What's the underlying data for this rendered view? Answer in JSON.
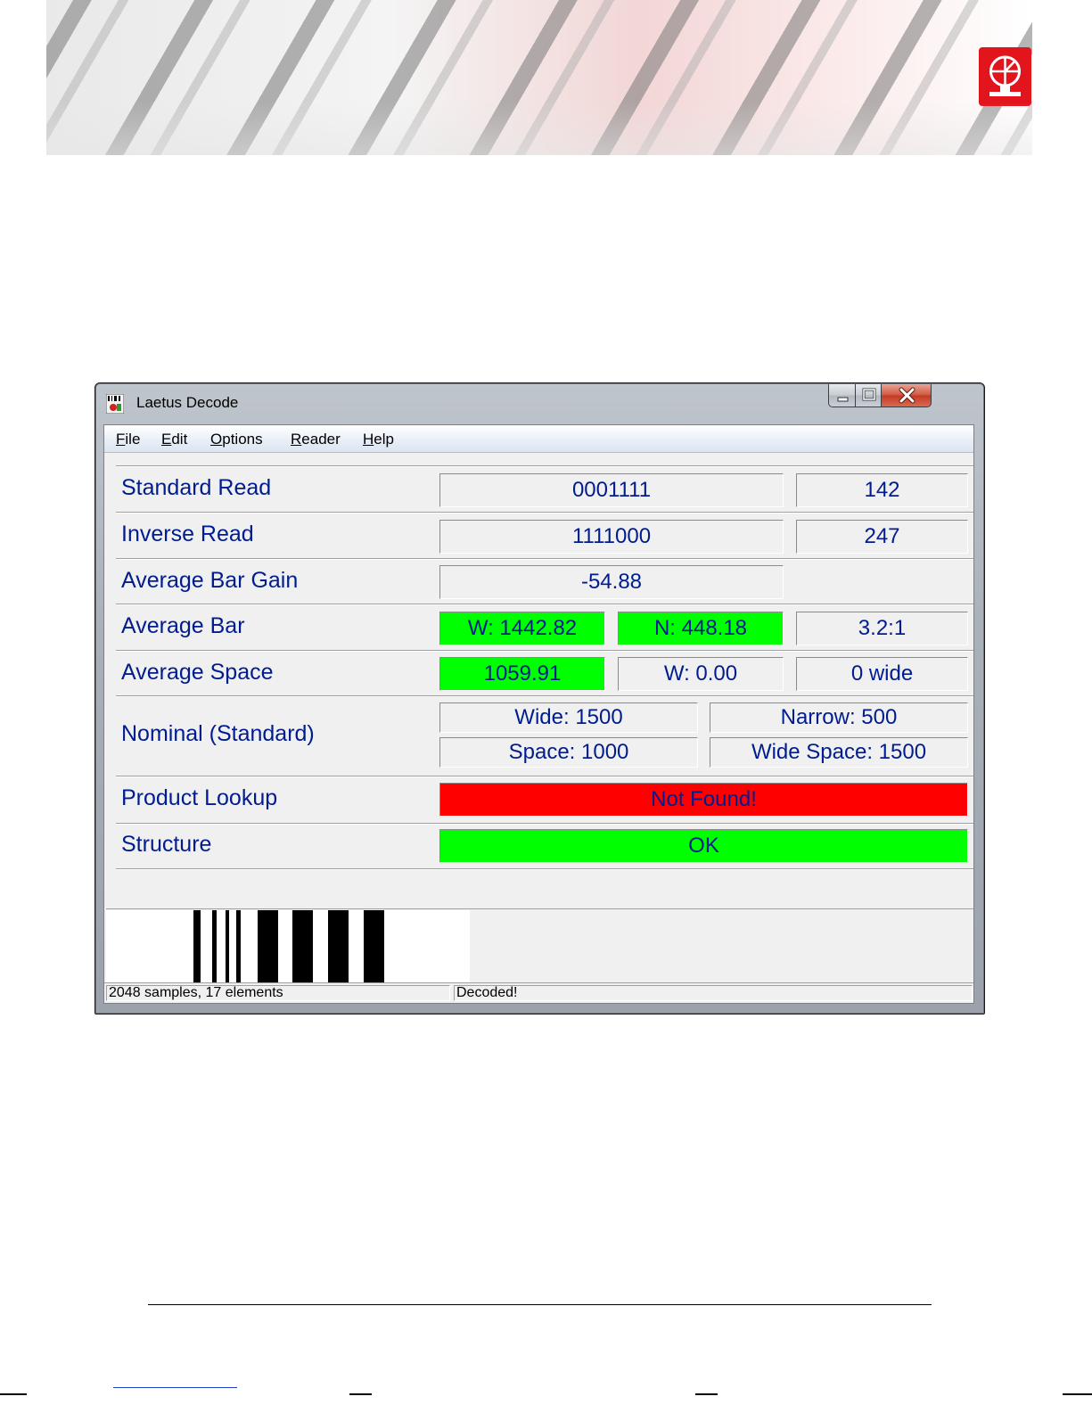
{
  "window": {
    "title": "Laetus Decode",
    "menu": [
      {
        "label": "File",
        "mnemonic": "F",
        "rest": "ile"
      },
      {
        "label": "Edit",
        "mnemonic": "E",
        "rest": "dit"
      },
      {
        "label": "Options",
        "mnemonic": "O",
        "rest": "ptions"
      },
      {
        "label": "Reader",
        "mnemonic": "R",
        "rest": "eader"
      },
      {
        "label": "Help",
        "mnemonic": "H",
        "rest": "elp"
      }
    ]
  },
  "rows": {
    "standard_read": {
      "label": "Standard Read",
      "value": "0001111",
      "count": "142"
    },
    "inverse_read": {
      "label": "Inverse Read",
      "value": "1111000",
      "count": "247"
    },
    "average_bar_gain": {
      "label": "Average Bar Gain",
      "value": "-54.88"
    },
    "average_bar": {
      "label": "Average Bar",
      "wide": "W: 1442.82",
      "narrow": "N: 448.18",
      "ratio": "3.2:1"
    },
    "average_space": {
      "label": "Average Space",
      "value": "1059.91",
      "wide": "W: 0.00",
      "wide_count": "0 wide"
    },
    "nominal": {
      "label": "Nominal (Standard)",
      "wide": "Wide: 1500",
      "narrow": "Narrow: 500",
      "space": "Space: 1000",
      "wide_space": "Wide Space: 1500"
    },
    "product_lookup": {
      "label": "Product Lookup",
      "value": "Not Found!"
    },
    "structure": {
      "label": "Structure",
      "value": "OK"
    }
  },
  "status": {
    "left": "2048 samples, 17 elements",
    "right": "Decoded!"
  },
  "colors": {
    "label_text": "#001c8f",
    "good": "#00ff00",
    "bad": "#ff0000",
    "brand": "#e2141c"
  },
  "icons": [
    "laetus-logo-icon",
    "app-icon",
    "minimize-icon",
    "maximize-icon",
    "close-icon"
  ]
}
